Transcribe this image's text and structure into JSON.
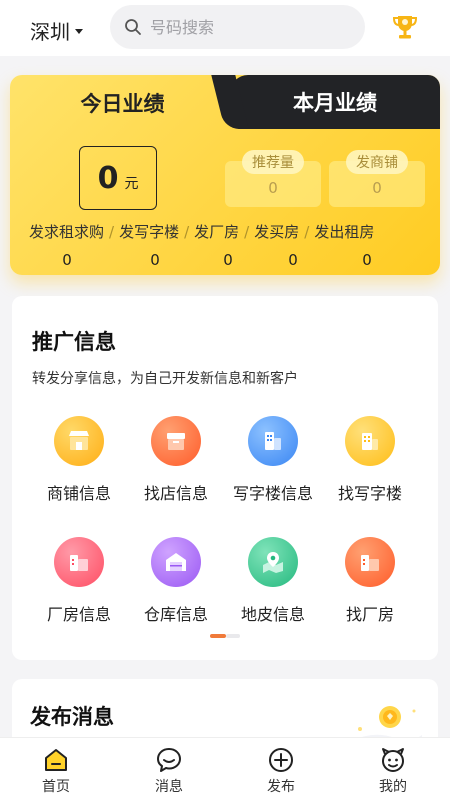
{
  "header": {
    "city": "深圳",
    "search_placeholder": "号码搜索"
  },
  "performance": {
    "tab_today": "今日业绩",
    "tab_month": "本月业绩",
    "main_value": "0",
    "main_unit": "元",
    "stats": [
      {
        "label": "推荐量",
        "value": "0"
      },
      {
        "label": "发商铺",
        "value": "0"
      }
    ],
    "metrics": [
      {
        "label": "发求租求购",
        "value": "0"
      },
      {
        "label": "发写字楼",
        "value": "0"
      },
      {
        "label": "发厂房",
        "value": "0"
      },
      {
        "label": "发买房",
        "value": "0"
      },
      {
        "label": "发出租房",
        "value": "0"
      }
    ],
    "metric_separator": "/"
  },
  "promo": {
    "title": "推广信息",
    "subtitle": "转发分享信息，为自己开发新信息和新客户",
    "items": [
      {
        "label": "商铺信息",
        "icon": "shop-icon"
      },
      {
        "label": "找店信息",
        "icon": "store-box-icon"
      },
      {
        "label": "写字楼信息",
        "icon": "office-building-icon"
      },
      {
        "label": "找写字楼",
        "icon": "find-office-icon"
      },
      {
        "label": "厂房信息",
        "icon": "factory-icon"
      },
      {
        "label": "仓库信息",
        "icon": "warehouse-icon"
      },
      {
        "label": "地皮信息",
        "icon": "land-map-icon"
      },
      {
        "label": "找厂房",
        "icon": "find-factory-icon"
      }
    ],
    "colors": {
      "shop": "#ffb21d",
      "store": "#ff6a3a",
      "office": "#3e8df5",
      "find_office": "#ffc21d",
      "factory": "#ff5a6e",
      "warehouse": "#a263f5",
      "land": "#2fc28a",
      "find_factory": "#ff6a3a"
    }
  },
  "publish": {
    "title": "发布消息"
  },
  "nav": {
    "items": [
      {
        "label": "首页",
        "icon": "home-icon",
        "active": true
      },
      {
        "label": "消息",
        "icon": "message-icon",
        "active": false
      },
      {
        "label": "发布",
        "icon": "plus-circle-icon",
        "active": false
      },
      {
        "label": "我的",
        "icon": "profile-face-icon",
        "active": false
      }
    ]
  }
}
